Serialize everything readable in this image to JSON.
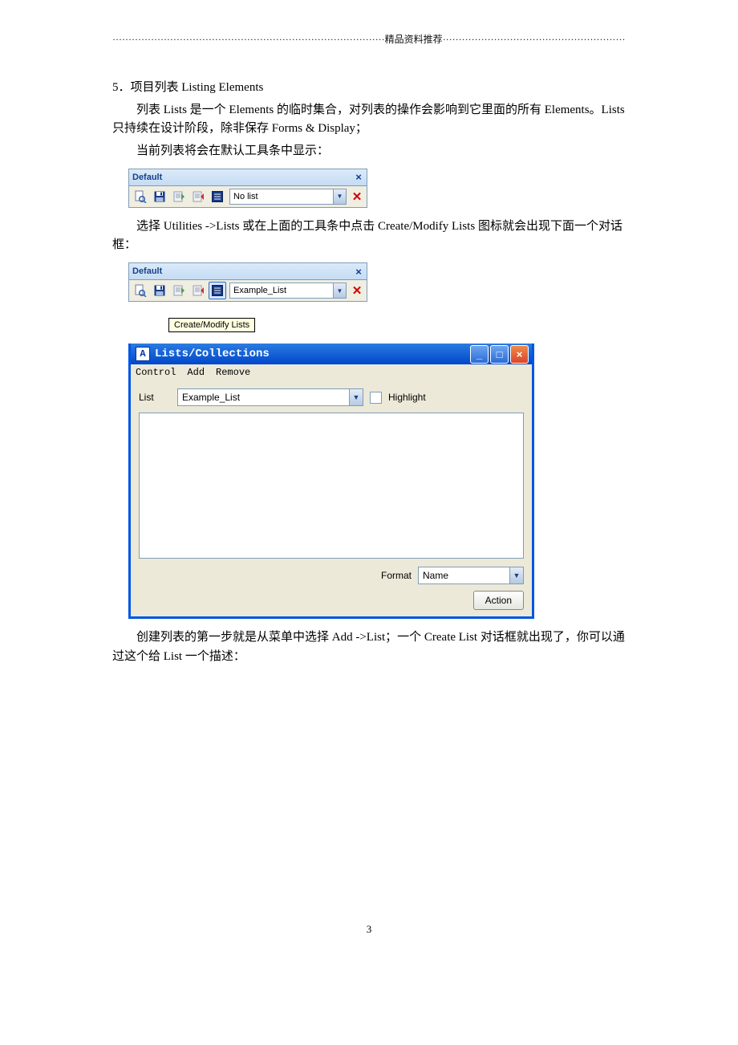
{
  "header_rule_label": "精品资料推荐",
  "section_title": "5．项目列表 Listing Elements",
  "para1": "列表 Lists 是一个 Elements 的临时集合，对列表的操作会影响到它里面的所有 Elements。Lists 只持续在设计阶段，除非保存 Forms & Display；",
  "para2": "当前列表将会在默认工具条中显示：",
  "toolbar1": {
    "title": "Default",
    "combo_value": "No list"
  },
  "para3": "选择 Utilities ->Lists 或在上面的工具条中点击 Create/Modify Lists 图标就会出现下面一个对话框：",
  "toolbar2": {
    "title": "Default",
    "combo_value": "Example_List"
  },
  "tooltip_text": "Create/Modify Lists",
  "window": {
    "title": "Lists/Collections",
    "menu": {
      "control": "Control",
      "add": "Add",
      "remove": "Remove"
    },
    "list_label": "List",
    "list_value": "Example_List",
    "highlight_label": "Highlight",
    "format_label": "Format",
    "format_value": "Name",
    "action_label": "Action"
  },
  "para4": "创建列表的第一步就是从菜单中选择 Add ->List；一个 Create List 对话框就出现了，你可以通过这个给 List 一个描述：",
  "page_number": "3"
}
